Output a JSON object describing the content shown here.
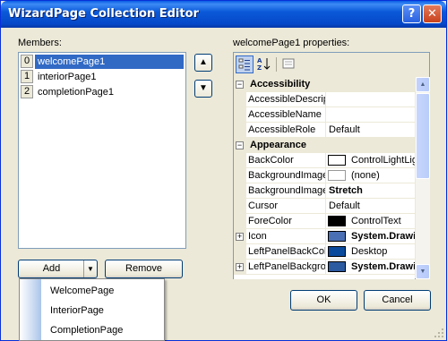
{
  "window": {
    "title": "WizardPage Collection Editor",
    "help_glyph": "?",
    "close_glyph": "✕"
  },
  "members": {
    "label": "Members:",
    "items": [
      {
        "index": "0",
        "name": "welcomePage1",
        "selected": true
      },
      {
        "index": "1",
        "name": "interiorPage1",
        "selected": false
      },
      {
        "index": "2",
        "name": "completionPage1",
        "selected": false
      }
    ]
  },
  "move_up_glyph": "▲",
  "move_down_glyph": "▼",
  "add_button": {
    "label": "Add",
    "dropdown_glyph": "▼"
  },
  "remove_button": {
    "label": "Remove"
  },
  "add_menu": {
    "items": [
      "WelcomePage",
      "InteriorPage",
      "CompletionPage"
    ]
  },
  "properties": {
    "label": "welcomePage1 properties:",
    "categorized_icon": "categorized-icon",
    "alphabetical_icon": "alphabetical-icon",
    "property_pages_icon": "property-pages-icon",
    "rows": [
      {
        "kind": "category",
        "name": "Accessibility",
        "expander": "−"
      },
      {
        "kind": "prop",
        "name": "AccessibleDescrip",
        "value": ""
      },
      {
        "kind": "prop",
        "name": "AccessibleName",
        "value": ""
      },
      {
        "kind": "prop",
        "name": "AccessibleRole",
        "value": "Default"
      },
      {
        "kind": "category",
        "name": "Appearance",
        "expander": "−"
      },
      {
        "kind": "prop",
        "name": "BackColor",
        "value": "ControlLightLigh",
        "swatch": "#ffffff"
      },
      {
        "kind": "prop",
        "name": "BackgroundImage",
        "value": "(none)",
        "swatch": "#ffffff"
      },
      {
        "kind": "prop",
        "name": "BackgroundImage",
        "value": "Stretch",
        "bold": true
      },
      {
        "kind": "prop",
        "name": "Cursor",
        "value": "Default"
      },
      {
        "kind": "prop",
        "name": "ForeColor",
        "value": "ControlText",
        "swatch": "#000000"
      },
      {
        "kind": "prop",
        "name": "Icon",
        "value": "System.Drawi",
        "bold": true,
        "swatch": "#4a6fb5",
        "expander": "+"
      },
      {
        "kind": "prop",
        "name": "LeftPanelBackColo",
        "value": "Desktop",
        "swatch": "#0a4a9c"
      },
      {
        "kind": "prop",
        "name": "LeftPanelBackgro",
        "value": "System.Drawi",
        "bold": true,
        "swatch": "#2c5aa0",
        "expander": "+"
      }
    ]
  },
  "ok_button": {
    "label": "OK"
  },
  "cancel_button": {
    "label": "Cancel"
  }
}
